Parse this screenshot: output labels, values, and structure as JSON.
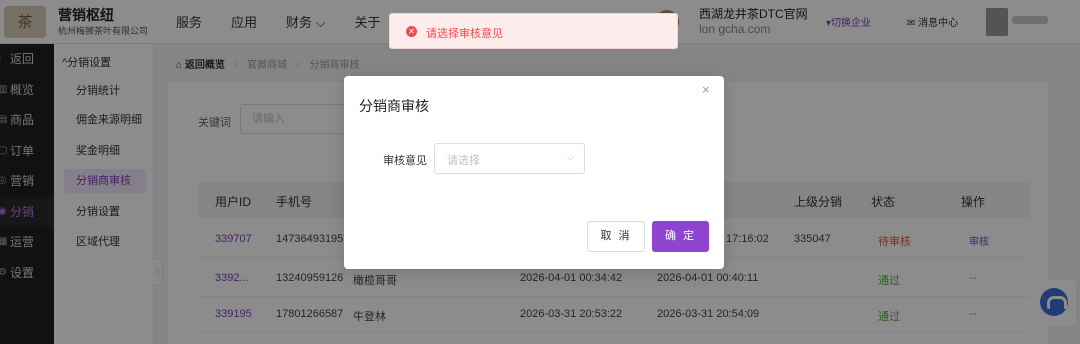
{
  "header": {
    "logo_glyph": "茶",
    "brand_title": "营销枢纽",
    "brand_subtitle": "杭州梅狮茶叶有限公司",
    "nav": [
      {
        "label": "服务"
      },
      {
        "label": "应用"
      },
      {
        "label": "财务 ⌵"
      },
      {
        "label": "关于"
      }
    ],
    "store_name": "西湖龙井茶DTC官网",
    "store_account": "lon   gcha.com",
    "switch_label": "▾切换企业",
    "message_label": "✉ 消息中心"
  },
  "sidebar": {
    "items": [
      {
        "icon": "‹",
        "label": "返回"
      },
      {
        "icon": "▥",
        "label": "概览"
      },
      {
        "icon": "▤",
        "label": "商品"
      },
      {
        "icon": "▢",
        "label": "订单"
      },
      {
        "icon": "◎",
        "label": "营销"
      },
      {
        "icon": "◉",
        "label": "分销"
      },
      {
        "icon": "▦",
        "label": "运营"
      },
      {
        "icon": "⚙",
        "label": "设置"
      }
    ],
    "active_index": 5
  },
  "subsidebar": {
    "group_label": "^分销设置",
    "items": [
      {
        "label": "分销统计"
      },
      {
        "label": "佣金来源明细"
      },
      {
        "label": "奖金明细"
      },
      {
        "label": "分销商审核"
      },
      {
        "label": "分销设置"
      },
      {
        "label": "区域代理"
      }
    ],
    "active_index": 3,
    "collapse_icon": "‹"
  },
  "breadcrumb": {
    "back": "返回概览",
    "items": [
      "官微商城",
      "分销商审核"
    ]
  },
  "filters": {
    "keyword_label": "关键词",
    "keyword_placeholder": "请输入"
  },
  "table": {
    "columns": [
      "用户ID",
      "手机号",
      "上级分销",
      "状态",
      "操作"
    ],
    "rows": [
      {
        "id": "339707",
        "phone": "14736493195",
        "nickname": "",
        "apply_time": "",
        "audit_time": "17:16:02",
        "parent": "335047",
        "status": "待审核",
        "status_type": "pending",
        "action": "审核"
      },
      {
        "id": "3392...",
        "phone": "13240959126",
        "nickname": "橄榄哥哥",
        "apply_time": "2026-04-01 00:34:42",
        "audit_time": "2026-04-01 00:40:11",
        "parent": "",
        "status": "通过",
        "status_type": "pass",
        "action": "--"
      },
      {
        "id": "339195",
        "phone": "17801266587",
        "nickname": "牛登林",
        "apply_time": "2026-03-31 20:53:22",
        "audit_time": "2026-03-31 20:54:09",
        "parent": "",
        "status": "通过",
        "status_type": "pass",
        "action": "--"
      }
    ]
  },
  "toast": {
    "icon": "✕",
    "message": "请选择审核意见",
    "color": "#ee4d4d"
  },
  "modal": {
    "title": "分销商审核",
    "close_icon": "×",
    "field_label": "审核意见",
    "select_placeholder": "请选择",
    "select_chevron": "⌵",
    "cancel_label": "取 消",
    "ok_label": "确 定",
    "accent_color": "#8e44cf"
  }
}
